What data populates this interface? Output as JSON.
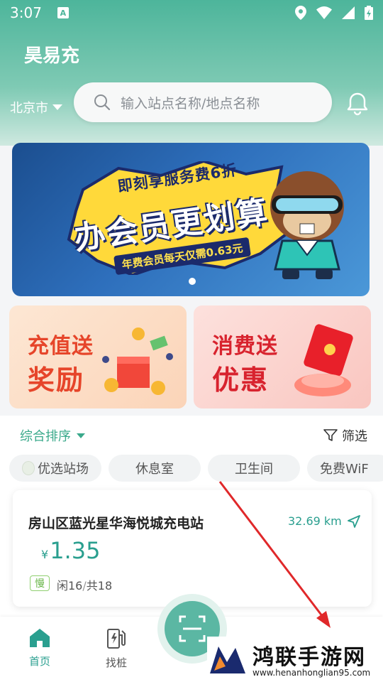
{
  "status": {
    "time": "3:07",
    "note_icon": "A"
  },
  "app": {
    "title": "昊易充"
  },
  "location": {
    "city": "北京市"
  },
  "search": {
    "placeholder": "输入站点名称/地点名称"
  },
  "banner": {
    "line1": "即刻享服务费6折",
    "line2": "办会员更划算",
    "line3": "年费会员每天仅需0.63元"
  },
  "promos": [
    {
      "line1": "充值送",
      "line2": "奖励"
    },
    {
      "line1": "消费送",
      "line2": "优惠"
    }
  ],
  "sort": {
    "label": "综合排序"
  },
  "filter": {
    "label": "筛选"
  },
  "chips": [
    "优选站场",
    "休息室",
    "卫生间",
    "免费WiF"
  ],
  "station": {
    "name": "房山区蓝光星华海悦城充电站",
    "distance": "32.69 km",
    "currency": "¥",
    "price": "1.35",
    "speed_tag": "慢",
    "free_label": "闲16",
    "sep": "/",
    "total_label": "共18"
  },
  "nav": [
    {
      "label": "首页",
      "icon": "home-icon",
      "active": true
    },
    {
      "label": "找桩",
      "icon": "charger-icon",
      "active": false
    }
  ],
  "watermark": {
    "text": "鸿联手游网",
    "url": "www.henanhonglian95.com"
  },
  "colors": {
    "accent": "#2a9f8f",
    "header": "#4db59b"
  }
}
